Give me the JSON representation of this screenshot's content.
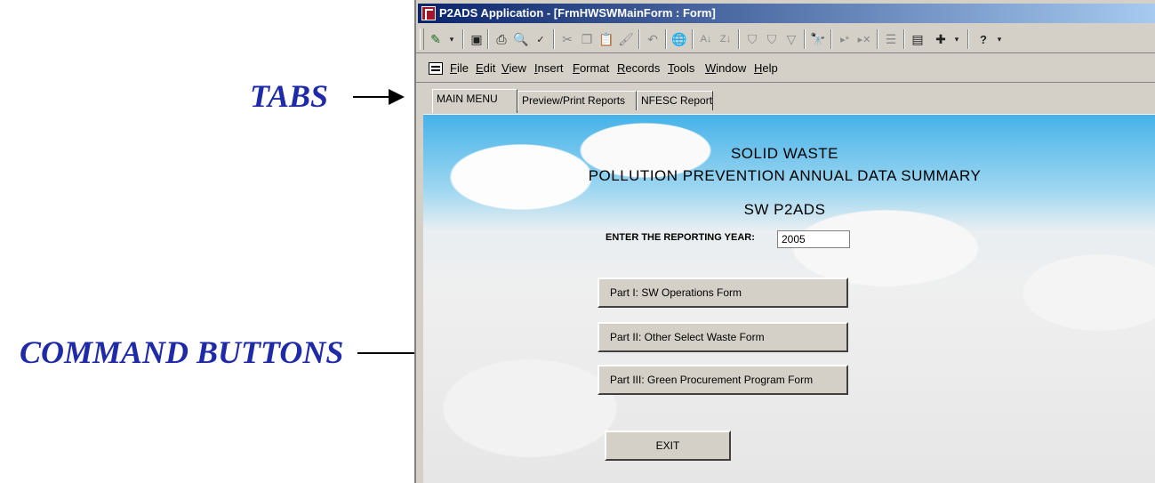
{
  "annotations": {
    "tabs_label": "TABS",
    "buttons_label": "COMMAND BUTTONS"
  },
  "window": {
    "title": "P2ADS Application - [FrmHWSWMainForm : Form]"
  },
  "toolbar": {
    "icons": [
      "design-view-icon",
      "dropdown-arrow-icon",
      "save-icon",
      "print-icon",
      "print-preview-icon",
      "spelling-icon",
      "cut-icon",
      "copy-icon",
      "paste-icon",
      "format-painter-icon",
      "undo-icon",
      "hyperlink-icon",
      "sort-ascending-icon",
      "sort-descending-icon",
      "filter-by-selection-icon",
      "filter-by-form-icon",
      "apply-filter-icon",
      "find-icon",
      "new-record-icon",
      "delete-record-icon",
      "properties-icon",
      "database-window-icon",
      "new-object-icon",
      "help-icon"
    ]
  },
  "menubar": {
    "items": [
      "File",
      "Edit",
      "View",
      "Insert",
      "Format",
      "Records",
      "Tools",
      "Window",
      "Help"
    ]
  },
  "tabs": [
    "MAIN MENU",
    "Preview/Print Reports",
    "NFESC Report"
  ],
  "form": {
    "heading1": "SOLID WASTE",
    "heading2": "POLLUTION PREVENTION ANNUAL DATA SUMMARY",
    "heading3": "SW P2ADS",
    "year_label": "ENTER THE REPORTING YEAR:",
    "year_value": "2005",
    "buttons": [
      "Part I:  SW Operations Form",
      "Part II:  Other Select Waste Form",
      "Part III: Green Procurement Program Form",
      "EXIT"
    ]
  },
  "colors": {
    "annotation": "#1f2aa8",
    "sky": "#45b2e8",
    "titlebar": "#0a246a"
  }
}
